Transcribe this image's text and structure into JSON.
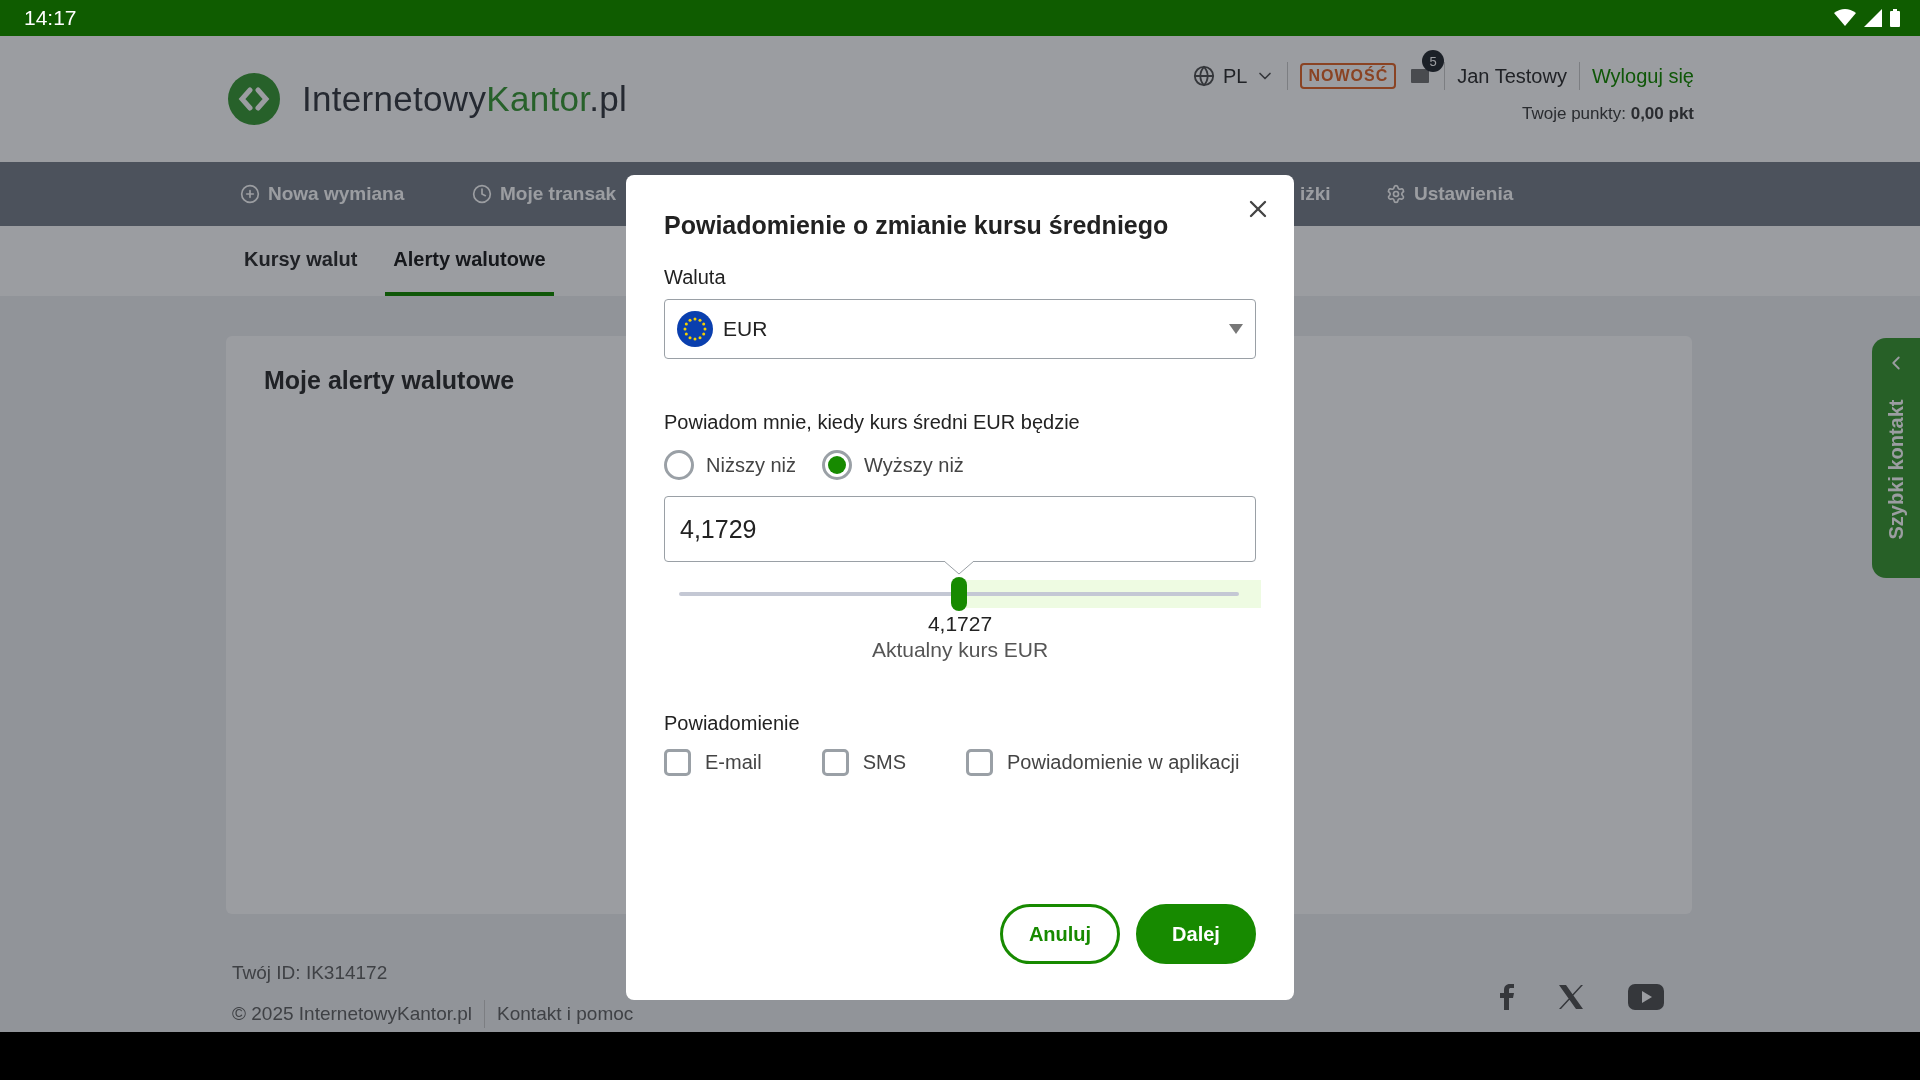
{
  "status_bar": {
    "time": "14:17"
  },
  "header": {
    "logo": {
      "dark": "Internetowy",
      "green": "Kantor",
      "suffix": ".pl"
    },
    "language": "PL",
    "badge": "NOWOŚĆ",
    "mail_count": "5",
    "user": "Jan Testowy",
    "logout": "Wyloguj się",
    "points_label": "Twoje punkty:",
    "points": "0,00 pkt"
  },
  "nav": [
    {
      "label": "Nowa wymiana"
    },
    {
      "label": "Moje transak"
    },
    {
      "label": "iżki"
    },
    {
      "label": "Ustawienia"
    }
  ],
  "subtabs": [
    {
      "label": "Kursy walut",
      "selected": false
    },
    {
      "label": "Alerty walutowe",
      "selected": true
    }
  ],
  "card": {
    "title": "Moje alerty walutowe"
  },
  "footer": {
    "user_id": "Twój ID: IK314172",
    "copyright": "© 2025 InternetowyKantor.pl",
    "link": "Kontakt i pomoc"
  },
  "side_tab": {
    "label": "Szybki kontakt"
  },
  "modal": {
    "title": "Powiadomienie o zmianie kursu średniego",
    "currency_label": "Waluta",
    "currency": "EUR",
    "condition_label": "Powiadom mnie, kiedy kurs średni EUR będzie",
    "options": [
      {
        "label": "Niższy niż",
        "selected": false
      },
      {
        "label": "Wyższy niż",
        "selected": true
      }
    ],
    "value": "4,1729",
    "slider": {
      "level": 0.5
    },
    "current_rate": "4,1727",
    "current_rate_label": "Aktualny kurs EUR",
    "notify_label": "Powiadomienie",
    "channels": [
      {
        "label": "E-mail",
        "checked": false
      },
      {
        "label": "SMS",
        "checked": false
      },
      {
        "label": "Powiadomienie w aplikacji",
        "checked": false
      }
    ],
    "cancel": "Anuluj",
    "next": "Dalej"
  }
}
